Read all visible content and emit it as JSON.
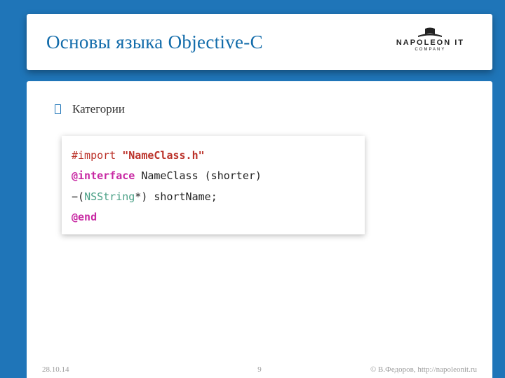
{
  "header": {
    "title": "Основы языка Objective-C",
    "logo": {
      "name": "NAPOLEON IT",
      "subtitle": "COMPANY"
    }
  },
  "bullet": "Категории",
  "code": {
    "line1": {
      "import": "#import",
      "file": "\"NameClass.h\""
    },
    "line2": {
      "kw": "@interface",
      "cls": "NameClass",
      "cat": "(shorter)"
    },
    "line3": {
      "ret": "NSString",
      "star": "*",
      "close": ")",
      "name": "shortName",
      "semi": ";"
    },
    "line4": "@end"
  },
  "footer": {
    "date": "28.10.14",
    "page": "9",
    "copyright": "© В.Федоров, http://napoleonit.ru"
  }
}
